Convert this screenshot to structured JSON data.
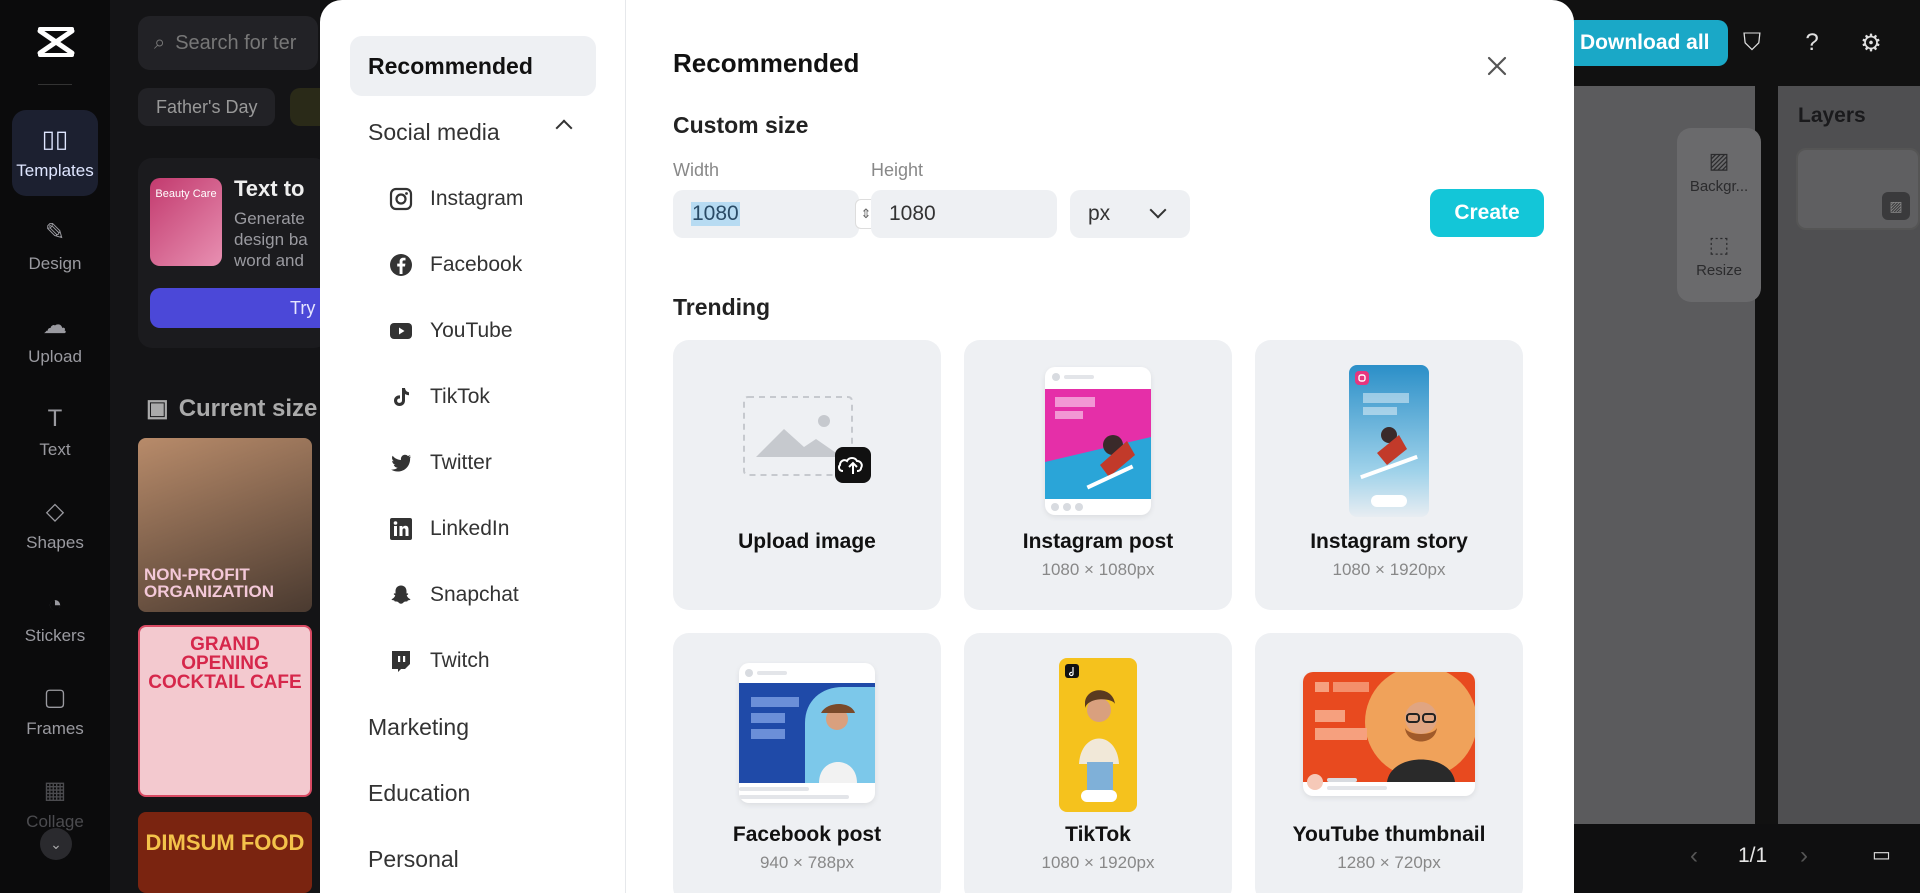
{
  "app": {
    "rail": [
      {
        "label": "Templates",
        "icon": "templates-icon"
      },
      {
        "label": "Design",
        "icon": "design-icon"
      },
      {
        "label": "Upload",
        "icon": "upload-icon"
      },
      {
        "label": "Text",
        "icon": "text-icon"
      },
      {
        "label": "Shapes",
        "icon": "shapes-icon"
      },
      {
        "label": "Stickers",
        "icon": "stickers-icon"
      },
      {
        "label": "Frames",
        "icon": "frames-icon"
      },
      {
        "label": "Collage",
        "icon": "collage-icon"
      }
    ],
    "search_placeholder": "Search for ter",
    "chips": [
      "Father's Day"
    ],
    "promo": {
      "thumb_text": "Beauty Care",
      "title": "Text to",
      "desc": "Generate design ba word and",
      "button": "Try"
    },
    "current_size": "Current size",
    "templates": [
      {
        "text": "NON-PROFIT ORGANIZATION"
      },
      {
        "text": "GRAND OPENING COCKTAIL CAFE"
      },
      {
        "text": "DIMSUM FOOD"
      }
    ],
    "download_all": "Download all",
    "tools": [
      {
        "label": "Backgr..."
      },
      {
        "label": "Resize"
      }
    ],
    "layers_title": "Layers",
    "pager": "1/1"
  },
  "modal": {
    "nav": {
      "recommended": "Recommended",
      "social_media": "Social media",
      "social_items": [
        {
          "label": "Instagram",
          "icon": "instagram-icon"
        },
        {
          "label": "Facebook",
          "icon": "facebook-icon"
        },
        {
          "label": "YouTube",
          "icon": "youtube-icon"
        },
        {
          "label": "TikTok",
          "icon": "tiktok-icon"
        },
        {
          "label": "Twitter",
          "icon": "twitter-icon"
        },
        {
          "label": "LinkedIn",
          "icon": "linkedin-icon"
        },
        {
          "label": "Snapchat",
          "icon": "snapchat-icon"
        },
        {
          "label": "Twitch",
          "icon": "twitch-icon"
        }
      ],
      "marketing": "Marketing",
      "education": "Education",
      "personal": "Personal"
    },
    "title": "Recommended",
    "custom_size": {
      "heading": "Custom size",
      "width_label": "Width",
      "height_label": "Height",
      "width_value": "1080",
      "height_value": "1080",
      "unit": "px",
      "create": "Create"
    },
    "trending": {
      "heading": "Trending",
      "cards": [
        {
          "label": "Upload image",
          "size": ""
        },
        {
          "label": "Instagram post",
          "size": "1080 × 1080px"
        },
        {
          "label": "Instagram story",
          "size": "1080 × 1920px"
        },
        {
          "label": "Facebook post",
          "size": "940 × 788px"
        },
        {
          "label": "TikTok",
          "size": "1080 × 1920px"
        },
        {
          "label": "YouTube thumbnail",
          "size": "1280 × 720px"
        }
      ]
    }
  },
  "colors": {
    "accent": "#13c6d8",
    "download": "#1aa8c7",
    "selected_nav": "#eef0f3"
  }
}
